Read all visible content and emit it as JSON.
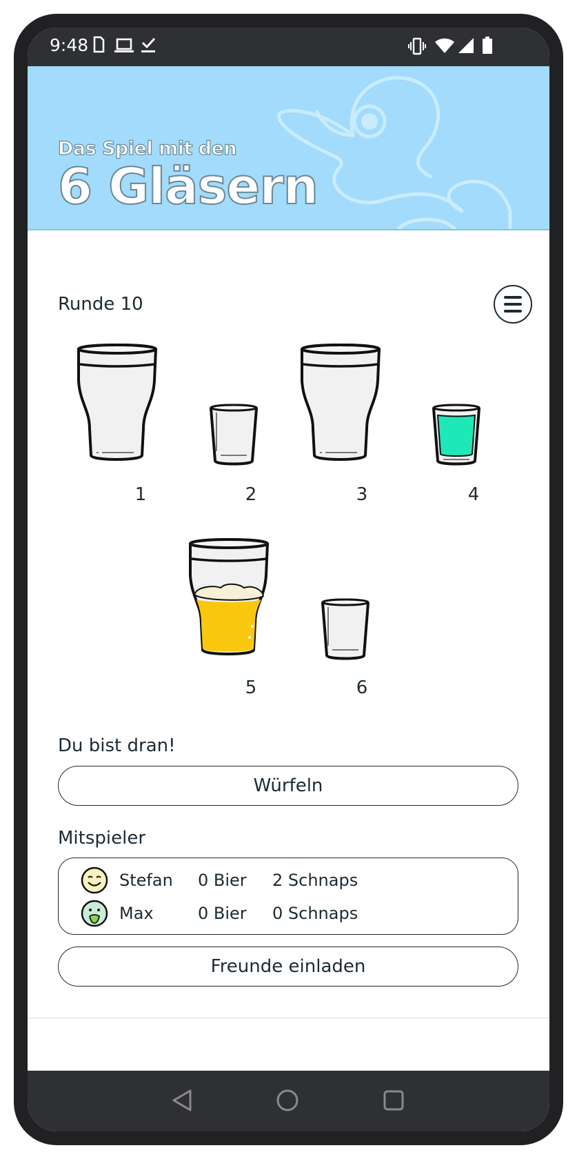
{
  "status_bar": {
    "time": "9:48",
    "left_icons": [
      "sim-card-icon",
      "laptop-icon",
      "checkmark-icon"
    ],
    "right_icons": [
      "vibrate-icon",
      "wifi-icon",
      "signal-icon",
      "battery-icon"
    ]
  },
  "header": {
    "subtitle": "Das Spiel mit den",
    "title": "6 Gläsern",
    "background_color": "#a2dbfb",
    "decoration": "duck-outline"
  },
  "game": {
    "round_label": "Runde 10",
    "glasses": [
      {
        "number": "1",
        "type": "beer-glass",
        "fill": "empty"
      },
      {
        "number": "2",
        "type": "shot-glass",
        "fill": "empty"
      },
      {
        "number": "3",
        "type": "beer-glass",
        "fill": "empty"
      },
      {
        "number": "4",
        "type": "shot-glass",
        "fill": "schnaps",
        "color": "#1ee8b8"
      },
      {
        "number": "5",
        "type": "beer-glass",
        "fill": "beer",
        "color": "#f9c80e"
      },
      {
        "number": "6",
        "type": "shot-glass",
        "fill": "empty"
      }
    ],
    "turn_label": "Du bist dran!",
    "roll_button": "Würfeln"
  },
  "players": {
    "label": "Mitspieler",
    "list": [
      {
        "name": "Stefan",
        "beer": "0 Bier",
        "schnaps": "2 Schnaps",
        "avatar": "smiling-face-icon"
      },
      {
        "name": "Max",
        "beer": "0 Bier",
        "schnaps": "0 Schnaps",
        "avatar": "sick-face-icon"
      }
    ],
    "invite_button": "Freunde einladen"
  },
  "nav_bar": {
    "buttons": [
      "back-icon",
      "home-icon",
      "recents-icon"
    ]
  }
}
